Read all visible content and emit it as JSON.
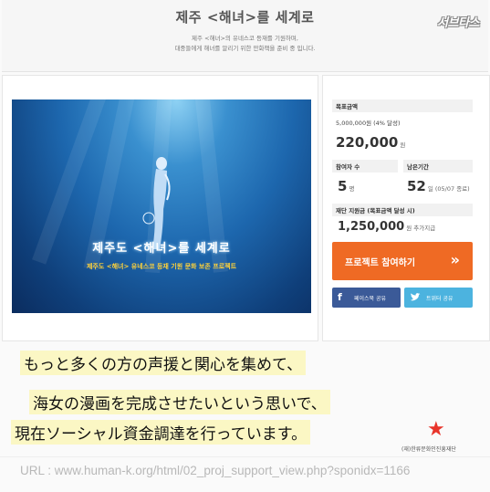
{
  "header": {
    "title": "제주 <해녀>를 세계로",
    "subtitle_1": "제주 <해녀>의 유네스코 등재를 기원하며,",
    "subtitle_2": "대중들에게 해녀를 알리기 위한 만화책을 준비 중 입니다.",
    "logo_text": "서브타스"
  },
  "image": {
    "title": "제주도 <해녀>를 세계로",
    "subtitle": "제주도 <해녀> 유네스코 등재 기원 문화 보존 프로젝트"
  },
  "stats": {
    "goal_label": "목표금액",
    "goal_detail": "5,000,000원 (4% 달성)",
    "raised_value": "220,000",
    "raised_unit": "원",
    "supporters_label": "참여자 수",
    "supporters_value": "5",
    "supporters_unit": "명",
    "remaining_label": "남은기간",
    "remaining_value": "52",
    "remaining_unit": "일",
    "remaining_date": "(05/07 종료)",
    "foundation_label": "재단 지원금 (목표금액 달성 시)",
    "foundation_value": "1,250,000",
    "foundation_unit": "원 추가지급"
  },
  "actions": {
    "participate_label": "프로젝트 참여하기",
    "participate_arrow": "»",
    "facebook_label": "페이스북 공유",
    "twitter_label": "트위터 공유"
  },
  "captions": {
    "line_1": "もっと多くの方の声援と関心を集めて、",
    "line_2": "海女の漫画を完成させたいという思いで、",
    "line_3": "現在ソーシャル資金調達を行っています。"
  },
  "foundation_name": "(재)한류문화인진흥재단",
  "url": "URL : www.human-k.org/html/02_proj_support_view.php?sponidx=1166",
  "colors": {
    "cta": "#ef6a24",
    "facebook": "#3b5a98",
    "twitter": "#4cb3df",
    "caption_bg": "#fbf7c4"
  }
}
